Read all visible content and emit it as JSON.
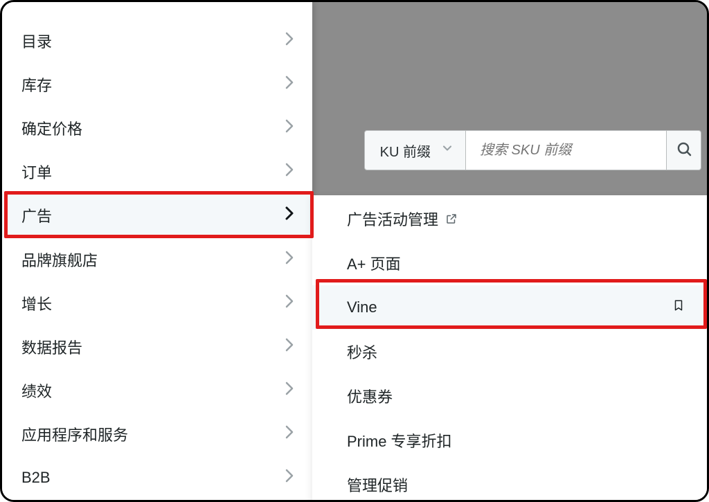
{
  "sidebar": {
    "items": [
      {
        "label": "目录"
      },
      {
        "label": "库存"
      },
      {
        "label": "确定价格"
      },
      {
        "label": "订单"
      },
      {
        "label": "广告"
      },
      {
        "label": "品牌旗舰店"
      },
      {
        "label": "增长"
      },
      {
        "label": "数据报告"
      },
      {
        "label": "绩效"
      },
      {
        "label": "应用程序和服务"
      },
      {
        "label": "B2B"
      }
    ],
    "active_index": 4
  },
  "submenu": {
    "items": [
      {
        "label": "广告活动管理",
        "external": true
      },
      {
        "label": "A+ 页面"
      },
      {
        "label": "Vine",
        "bookmark": true
      },
      {
        "label": "秒杀"
      },
      {
        "label": "优惠券"
      },
      {
        "label": "Prime 专享折扣"
      },
      {
        "label": "管理促销"
      }
    ],
    "hover_index": 2
  },
  "search": {
    "dropdown_visible_text": "KU 前缀",
    "placeholder": "搜索 SKU 前缀"
  },
  "highlight_color": "#e11b1b"
}
